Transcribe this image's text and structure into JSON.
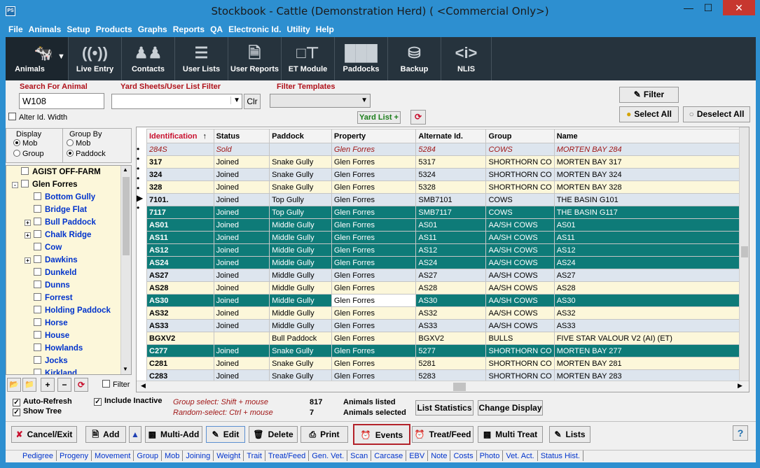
{
  "window": {
    "title": "Stockbook - Cattle (Demonstration Herd) ( <Commercial Only>)",
    "app_icon": "PS"
  },
  "menu": [
    "File",
    "Animals",
    "Setup",
    "Products",
    "Graphs",
    "Reports",
    "QA",
    "Electronic Id.",
    "Utility",
    "Help"
  ],
  "toolbar": [
    {
      "label": "Animals",
      "icon": "cow-icon"
    },
    {
      "label": "Live Entry",
      "icon": "signal-icon"
    },
    {
      "label": "Contacts",
      "icon": "people-icon"
    },
    {
      "label": "User Lists",
      "icon": "checklist-icon"
    },
    {
      "label": "User Reports",
      "icon": "report-icon"
    },
    {
      "label": "ET Module",
      "icon": "hierarchy-icon"
    },
    {
      "label": "Paddocks",
      "icon": "fence-icon"
    },
    {
      "label": "Backup",
      "icon": "database-icon"
    },
    {
      "label": "NLIS",
      "icon": "tag-icon"
    }
  ],
  "search": {
    "label": "Search For Animal",
    "value": "W108",
    "alter_label": "Alter Id. Width"
  },
  "yard_filter": {
    "label": "Yard Sheets/User List Filter",
    "clr": "Clr",
    "yard_list": "Yard List +"
  },
  "filter_templates": {
    "label": "Filter Templates"
  },
  "filter_buttons": {
    "filter": "Filter",
    "select_all": "Select All",
    "deselect_all": "Deselect All"
  },
  "display": {
    "label": "Display",
    "options": [
      "Mob",
      "Group"
    ],
    "selected": "Mob"
  },
  "group_by": {
    "label": "Group By",
    "options": [
      "Mob",
      "Paddock"
    ],
    "selected": "Paddock"
  },
  "tree": [
    {
      "label": "AGIST OFF-FARM",
      "level": 0,
      "expand": ""
    },
    {
      "label": "Glen Forres",
      "level": 0,
      "expand": "-"
    },
    {
      "label": "Bottom Gully",
      "level": 1,
      "expand": ""
    },
    {
      "label": "Bridge Flat",
      "level": 1,
      "expand": ""
    },
    {
      "label": "Bull Paddock",
      "level": 1,
      "expand": "+"
    },
    {
      "label": "Chalk Ridge",
      "level": 1,
      "expand": "+"
    },
    {
      "label": "Cow",
      "level": 1,
      "expand": ""
    },
    {
      "label": "Dawkins",
      "level": 1,
      "expand": "+"
    },
    {
      "label": "Dunkeld",
      "level": 1,
      "expand": ""
    },
    {
      "label": "Dunns",
      "level": 1,
      "expand": ""
    },
    {
      "label": "Forrest",
      "level": 1,
      "expand": ""
    },
    {
      "label": "Holding Paddock",
      "level": 1,
      "expand": ""
    },
    {
      "label": "Horse",
      "level": 1,
      "expand": ""
    },
    {
      "label": "House",
      "level": 1,
      "expand": ""
    },
    {
      "label": "Howlands",
      "level": 1,
      "expand": ""
    },
    {
      "label": "Jocks",
      "level": 1,
      "expand": ""
    },
    {
      "label": "Kirkland",
      "level": 1,
      "expand": ""
    }
  ],
  "tree_filter": "Filter",
  "grid": {
    "columns": [
      "Identification",
      "Status",
      "Paddock",
      "Property",
      "Alternate Id.",
      "Group",
      "Name"
    ],
    "sort_indicator": "↑",
    "rows": [
      {
        "c": [
          "284S",
          "Sold",
          "",
          "Glen Forres",
          "5284",
          "COWS",
          "MORTEN BAY 284"
        ],
        "style": "red",
        "mark": ""
      },
      {
        "c": [
          "317",
          "Joined",
          "Snake Gully",
          "Glen Forres",
          "5317",
          "SHORTHORN CO",
          "MORTEN BAY 317"
        ],
        "style": "odd",
        "mark": ""
      },
      {
        "c": [
          "324",
          "Joined",
          "Snake Gully",
          "Glen Forres",
          "5324",
          "SHORTHORN CO",
          "MORTEN BAY 324"
        ],
        "style": "even",
        "mark": ""
      },
      {
        "c": [
          "328",
          "Joined",
          "Snake Gully",
          "Glen Forres",
          "5328",
          "SHORTHORN CO",
          "MORTEN BAY 328"
        ],
        "style": "odd",
        "mark": ""
      },
      {
        "c": [
          "7101.",
          "Joined",
          "Top Gully",
          "Glen Forres",
          "SMB7101",
          "COWS",
          "THE BASIN G101"
        ],
        "style": "even",
        "mark": ""
      },
      {
        "c": [
          "7117",
          "Joined",
          "Top Gully",
          "Glen Forres",
          "SMB7117",
          "COWS",
          "THE BASIN G117"
        ],
        "style": "sel",
        "mark": "•"
      },
      {
        "c": [
          "AS01",
          "Joined",
          "Middle Gully",
          "Glen Forres",
          "AS01",
          "AA/SH COWS",
          "AS01"
        ],
        "style": "sel",
        "mark": "•"
      },
      {
        "c": [
          "AS11",
          "Joined",
          "Middle Gully",
          "Glen Forres",
          "AS11",
          "AA/SH COWS",
          "AS11"
        ],
        "style": "sel",
        "mark": "•"
      },
      {
        "c": [
          "AS12",
          "Joined",
          "Middle Gully",
          "Glen Forres",
          "AS12",
          "AA/SH COWS",
          "AS12"
        ],
        "style": "sel",
        "mark": "•"
      },
      {
        "c": [
          "AS24",
          "Joined",
          "Middle Gully",
          "Glen Forres",
          "AS24",
          "AA/SH COWS",
          "AS24"
        ],
        "style": "sel",
        "mark": "•"
      },
      {
        "c": [
          "AS27",
          "Joined",
          "Middle Gully",
          "Glen Forres",
          "AS27",
          "AA/SH COWS",
          "AS27"
        ],
        "style": "even",
        "mark": ""
      },
      {
        "c": [
          "AS28",
          "Joined",
          "Middle Gully",
          "Glen Forres",
          "AS28",
          "AA/SH COWS",
          "AS28"
        ],
        "style": "odd",
        "mark": ""
      },
      {
        "c": [
          "AS30",
          "Joined",
          "Middle Gully",
          "Glen Forres",
          "AS30",
          "AA/SH COWS",
          "AS30"
        ],
        "style": "cur",
        "mark": "▶"
      },
      {
        "c": [
          "AS32",
          "Joined",
          "Middle Gully",
          "Glen Forres",
          "AS32",
          "AA/SH COWS",
          "AS32"
        ],
        "style": "odd",
        "mark": ""
      },
      {
        "c": [
          "AS33",
          "Joined",
          "Middle Gully",
          "Glen Forres",
          "AS33",
          "AA/SH COWS",
          "AS33"
        ],
        "style": "even",
        "mark": ""
      },
      {
        "c": [
          "BGXV2",
          "",
          "Bull Paddock",
          "Glen Forres",
          "BGXV2",
          "BULLS",
          "FIVE STAR VALOUR V2 (AI) (ET)"
        ],
        "style": "odd",
        "mark": ""
      },
      {
        "c": [
          "C277",
          "Joined",
          "Snake Gully",
          "Glen Forres",
          "5277",
          "SHORTHORN CO",
          "MORTEN BAY 277"
        ],
        "style": "sel",
        "mark": "•"
      },
      {
        "c": [
          "C281",
          "Joined",
          "Snake Gully",
          "Glen Forres",
          "5281",
          "SHORTHORN CO",
          "MORTEN BAY 281"
        ],
        "style": "odd",
        "mark": ""
      },
      {
        "c": [
          "C283",
          "Joined",
          "Snake Gully",
          "Glen Forres",
          "5283",
          "SHORTHORN CO",
          "MORTEN BAY 283"
        ],
        "style": "even",
        "mark": ""
      }
    ]
  },
  "options": {
    "auto_refresh": "Auto-Refresh",
    "show_tree": "Show Tree",
    "include_inactive": "Include Inactive"
  },
  "notes": {
    "group_select": "Group select: Shift + mouse",
    "random_select": "Random-select: Ctrl + mouse"
  },
  "counts": {
    "listed": "817",
    "listed_label": "Animals listed",
    "selected": "7",
    "selected_label": "Animals selected"
  },
  "stats_buttons": {
    "list_statistics": "List Statistics",
    "change_display": "Change Display"
  },
  "actions": [
    {
      "label": "Cancel/Exit",
      "icon": "cancel-icon"
    },
    {
      "label": "Add",
      "icon": "add-icon"
    },
    {
      "label": "Multi-Add",
      "icon": "multi-add-icon"
    },
    {
      "label": "Edit",
      "icon": "edit-icon"
    },
    {
      "label": "Delete",
      "icon": "delete-icon"
    },
    {
      "label": "Print",
      "icon": "print-icon"
    },
    {
      "label": "Events",
      "icon": "alarm-clock-icon"
    },
    {
      "label": "Treat/Feed",
      "icon": "alarm-clock-icon"
    },
    {
      "label": "Multi Treat",
      "icon": "multi-treat-icon"
    },
    {
      "label": "Lists",
      "icon": "lists-icon"
    }
  ],
  "help": "?",
  "tabs": [
    "Pedigree",
    "Progeny",
    "Movement",
    "Group",
    "Mob",
    "Joining",
    "Weight",
    "Trait",
    "Treat/Feed",
    "Gen. Vet.",
    "Scan",
    "Carcase",
    "EBV",
    "Note",
    "Costs",
    "Photo",
    "Vet. Act.",
    "Status Hist."
  ],
  "colors": {
    "titlebar": "#2d8fd0",
    "toolbar": "#26333d",
    "selected_row": "#0e7b78",
    "tree_bg": "#fcf7da",
    "close": "#c7372f"
  }
}
